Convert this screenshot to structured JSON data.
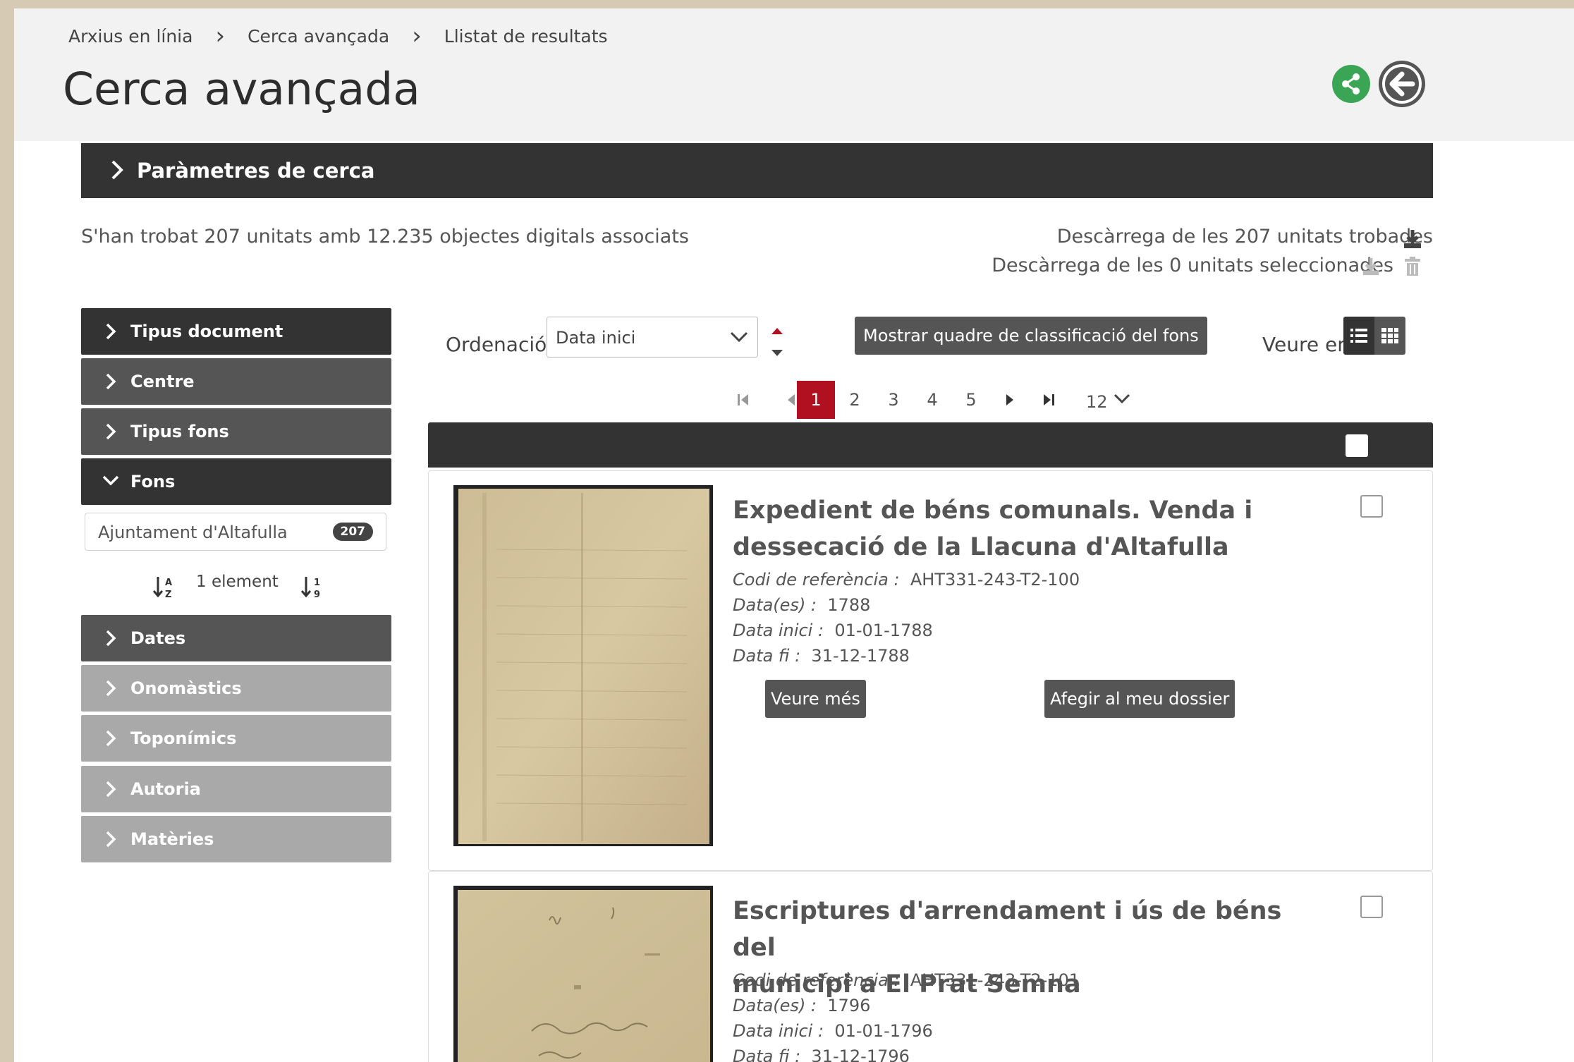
{
  "breadcrumb": [
    "Arxius en línia",
    "Cerca avançada",
    "Llistat de resultats"
  ],
  "page_title": "Cerca avançada",
  "params_label": "Paràmetres de cerca",
  "found_text": "S'han trobat 207 unitats amb 12.235 objectes digitals associats",
  "download_all": "Descàrrega de les 207 unitats trobades",
  "download_selected": "Descàrrega de les 0 unitats seleccionades",
  "facets": [
    {
      "label": "Tipus document",
      "expanded": false
    },
    {
      "label": "Centre",
      "expanded": false
    },
    {
      "label": "Tipus fons",
      "expanded": false
    },
    {
      "label": "Fons",
      "expanded": true
    },
    {
      "label": "Dates",
      "expanded": false
    },
    {
      "label": "Onomàstics",
      "expanded": false
    },
    {
      "label": "Toponímics",
      "expanded": false
    },
    {
      "label": "Autoria",
      "expanded": false
    },
    {
      "label": "Matèries",
      "expanded": false
    }
  ],
  "fons_item": {
    "name": "Ajuntament d'Altafulla",
    "count": "207"
  },
  "fons_count_text": "1 element",
  "ordenacio": {
    "label": "Ordenació",
    "value": "Data inici"
  },
  "mostrar_button": "Mostrar quadre de classificació del fons",
  "veure_label": "Veure en",
  "pagination": {
    "pages": [
      "1",
      "2",
      "3",
      "4",
      "5"
    ],
    "current": "1",
    "per_page": "12"
  },
  "results": [
    {
      "title_line1": "Expedient de béns comunals. Venda i",
      "title_line2": "dessecació de la Llacuna d'Altafulla",
      "ref_label": "Codi de referència :",
      "ref": "AHT331-243-T2-100",
      "dates_label": "Data(es) :",
      "dates": "1788",
      "start_label": "Data inici :",
      "start": "01-01-1788",
      "end_label": "Data fi :",
      "end": "31-12-1788",
      "more_button": "Veure més",
      "add_button": "Afegir al meu dossier"
    },
    {
      "title_line1": "Escriptures d'arrendament i ús de béns del",
      "title_line2": "municipi a El Prat Semna",
      "ref_label": "Codi de referència :",
      "ref": "AHT331-243-T2-101",
      "dates_label": "Data(es) :",
      "dates": "1796",
      "start_label": "Data inici :",
      "start": "01-01-1796",
      "end_label": "Data fi :",
      "end": "31-12-1796"
    }
  ],
  "colors": {
    "share": "#3ba556",
    "active_page": "#b01020",
    "dark_bar": "#333333"
  }
}
